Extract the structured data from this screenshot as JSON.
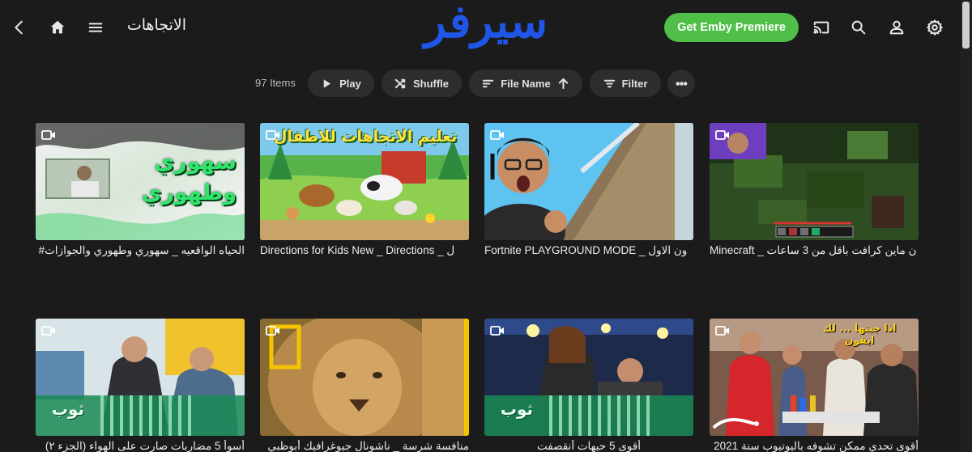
{
  "header": {
    "title": "الاتجاهات",
    "logo_text": "سيرفر",
    "premiere_label": "Get Emby Premiere",
    "colors": {
      "premiere": "#4fbf47",
      "logo": "#1f56e8",
      "background": "#1b1b1b"
    }
  },
  "toolbar": {
    "count": "97 Items",
    "play_label": "Play",
    "shuffle_label": "Shuffle",
    "sort_label": "File Name",
    "filter_label": "Filter"
  },
  "items": [
    {
      "title": "الحياه الواقعيه _ سهوري وطهوري والجوازات#",
      "thumb_text": "سهوري وطهوري"
    },
    {
      "title": "Directions for Kids New _ Directions _ ل",
      "thumb_text": "تعليم الاتجاهات للاطفال"
    },
    {
      "title": "Fortnite PLAYGROUND MODE _ ون الاول"
    },
    {
      "title": "Minecraft _ ن ماين كرافت باقل من 3 ساعات"
    },
    {
      "title": "أسوأ 5 مضاربات صارت على الهواء (الجزء ٢)",
      "thumb_text": "ثوب"
    },
    {
      "title": "منافسة شرسة _ ناشونال جيوغرافيك أبوظبي"
    },
    {
      "title": "أقوى 5 حيهات أنقصفت",
      "thumb_text": "ثوب"
    },
    {
      "title": "أقوى تحدي ممكن تشوفه باليوتيوب سنة 2021",
      "thumb_text": "اذا جبتها ... لك ايفون"
    }
  ]
}
